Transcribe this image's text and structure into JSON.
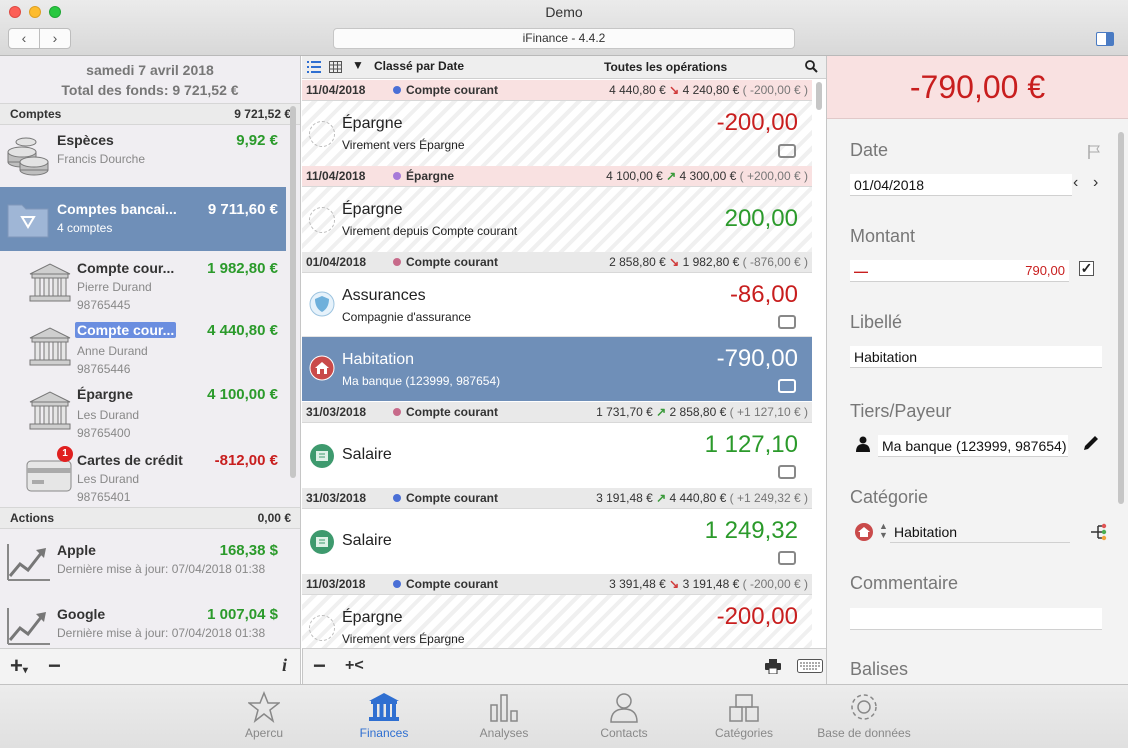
{
  "window": {
    "title": "Demo",
    "version": "iFinance - 4.4.2",
    "nav_back": "‹",
    "nav_forward": "›"
  },
  "left": {
    "date": "samedi 7 avril 2018",
    "total": "Total des fonds: 9 721,52 €",
    "sections": {
      "comptes": {
        "label": "Comptes",
        "amount": "9 721,52 €"
      },
      "actions": {
        "label": "Actions",
        "amount": "0,00 €"
      }
    },
    "accounts": [
      {
        "name": "Espèces",
        "sub1": "Francis Dourche",
        "amount": "9,92 €",
        "icon": "coins-icon"
      },
      {
        "name": "Comptes bancai...",
        "sub1": "4 comptes",
        "amount": "9 711,60 €",
        "icon": "folder-icon"
      },
      {
        "name": "Compte cour...",
        "sub1": "Pierre Durand",
        "sub2": "98765445",
        "amount": "1 982,80 €",
        "icon": "bank-icon"
      },
      {
        "name": "Compte cour...",
        "sub1": "Anne Durand",
        "sub2": "98765446",
        "amount": "4 440,80 €",
        "icon": "bank-icon"
      },
      {
        "name": "Épargne",
        "sub1": "Les Durand",
        "sub2": "98765400",
        "amount": "4 100,00 €",
        "icon": "bank-icon"
      },
      {
        "name": "Cartes de crédit",
        "sub1": "Les Durand",
        "sub2": "98765401",
        "amount": "-812,00 €",
        "icon": "credit-card-icon",
        "badge": "1"
      }
    ],
    "stocks": [
      {
        "name": "Apple",
        "sub1": "Dernière mise à jour: 07/04/2018 01:38",
        "amount": "168,38 $",
        "icon": "chart-up-icon"
      },
      {
        "name": "Google",
        "sub1": "Dernière mise à jour: 07/04/2018 01:38",
        "amount": "1 007,04 $",
        "icon": "chart-up-icon"
      }
    ]
  },
  "middle": {
    "sort_label": "Classé par Date",
    "filter_label": "Toutes les opérations",
    "groups": [
      {
        "date": "11/04/2018",
        "account": "Compte courant",
        "dot": "#4a6fd6",
        "from": "4 440,80 €",
        "to": "4 240,80 €",
        "delta": "( -200,00 € )",
        "dir": "down",
        "style": "red"
      },
      {
        "date": "11/04/2018",
        "account": "Épargne",
        "dot": "#a77ad8",
        "from": "4 100,00 €",
        "to": "4 300,00 €",
        "delta": "( +200,00 € )",
        "dir": "up",
        "style": "red"
      },
      {
        "date": "01/04/2018",
        "account": "Compte courant",
        "dot": "#c76a8a",
        "from": "2 858,80 €",
        "to": "1 982,80 €",
        "delta": "( -876,00 € )",
        "dir": "down",
        "style": "grey"
      },
      {
        "date": "31/03/2018",
        "account": "Compte courant",
        "dot": "#c76a8a",
        "from": "1 731,70 €",
        "to": "2 858,80 €",
        "delta": "( +1 127,10 € )",
        "dir": "up",
        "style": "grey"
      },
      {
        "date": "31/03/2018",
        "account": "Compte courant",
        "dot": "#4a6fd6",
        "from": "3 191,48 €",
        "to": "4 440,80 €",
        "delta": "( +1 249,32 € )",
        "dir": "up",
        "style": "grey"
      },
      {
        "date": "11/03/2018",
        "account": "Compte courant",
        "dot": "#4a6fd6",
        "from": "3 391,48 €",
        "to": "3 191,48 €",
        "delta": "( -200,00 € )",
        "dir": "down",
        "style": "grey"
      }
    ],
    "transactions": [
      {
        "title": "Épargne",
        "sub": "Virement vers Épargne",
        "amount": "-200,00",
        "sign": "neg",
        "icon": "transfer-icon"
      },
      {
        "title": "Épargne",
        "sub": "Virement depuis Compte courant",
        "amount": "200,00",
        "sign": "pos",
        "icon": "transfer-icon"
      },
      {
        "title": "Assurances",
        "sub": "Compagnie d'assurance",
        "amount": "-86,00",
        "sign": "neg",
        "icon": "shield-icon"
      },
      {
        "title": "Habitation",
        "sub": "Ma banque (123999, 987654)",
        "amount": "-790,00",
        "sign": "neg",
        "icon": "house-icon"
      },
      {
        "title": "Salaire",
        "sub": "",
        "amount": "1 127,10",
        "sign": "pos",
        "icon": "salary-icon"
      },
      {
        "title": "Salaire",
        "sub": "",
        "amount": "1 249,32",
        "sign": "pos",
        "icon": "salary-icon"
      },
      {
        "title": "Épargne",
        "sub": "Virement vers Épargne",
        "amount": "-200,00",
        "sign": "neg",
        "icon": "transfer-icon"
      }
    ]
  },
  "detail": {
    "amount": "-790,00 €",
    "date_label": "Date",
    "date_value": "01/04/2018",
    "montant_label": "Montant",
    "montant_sign": "—",
    "montant_value": "790,00",
    "libelle_label": "Libellé",
    "libelle_value": "Habitation",
    "tiers_label": "Tiers/Payeur",
    "tiers_value": "Ma banque (123999, 987654)",
    "categorie_label": "Catégorie",
    "categorie_value": "Habitation",
    "commentaire_label": "Commentaire",
    "commentaire_value": "",
    "balises_label": "Balises"
  },
  "tabs": [
    {
      "label": "Apercu",
      "icon": "star-icon"
    },
    {
      "label": "Finances",
      "icon": "bank-icon",
      "active": true
    },
    {
      "label": "Analyses",
      "icon": "bar-chart-icon"
    },
    {
      "label": "Contacts",
      "icon": "person-icon"
    },
    {
      "label": "Catégories",
      "icon": "categories-icon"
    },
    {
      "label": "Base de données",
      "icon": "gear-icon"
    }
  ],
  "colors": {
    "positive": "#2b9a2b",
    "negative": "#c81e1e",
    "accent": "#2f6fd1",
    "selection": "#6f8fb8"
  }
}
